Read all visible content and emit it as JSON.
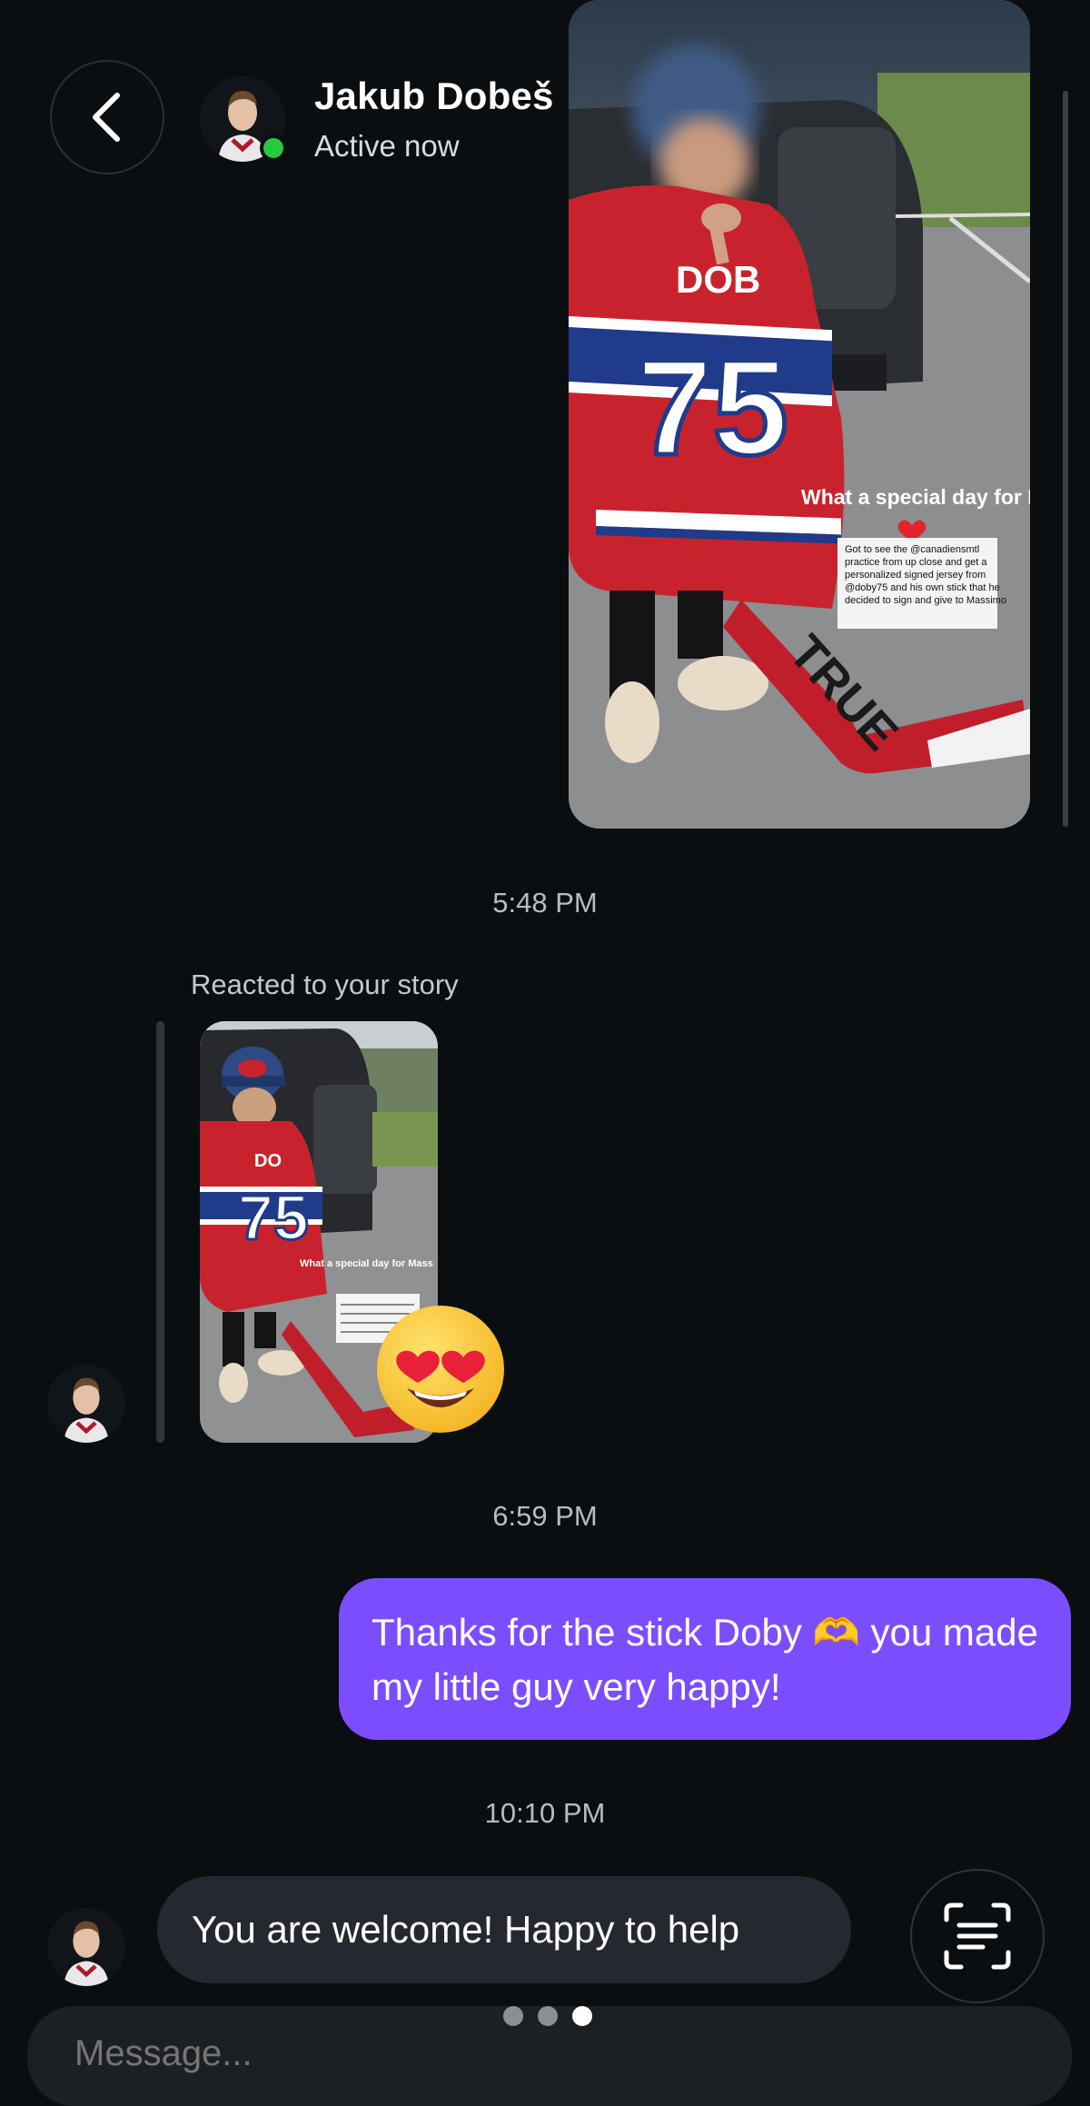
{
  "header": {
    "contact_name": "Jakub Dobeš",
    "status": "Active now",
    "verified": true,
    "icons": {
      "back": "chevron-left-icon",
      "verified": "verified-badge-icon"
    }
  },
  "thread": {
    "story_photo": {
      "jersey_name": "DOB",
      "jersey_number": "75",
      "caption_title": "What a special day for Mass",
      "caption_body": "Got to see the @canadiensmtl practice from up close and get a personalized signed jersey from @doby75 and his own stick that he decided to sign and give to Massimo",
      "stick_brand": "TRUE"
    },
    "timestamp_1": "5:48 PM",
    "reacted_label": "Reacted to your story",
    "reaction_emoji": "😍",
    "timestamp_2": "6:59 PM",
    "outgoing_message": "Thanks for the stick Doby 🫶 you made my little guy very happy!",
    "timestamp_3": "10:10 PM",
    "incoming_message": "You are welcome! Happy to help"
  },
  "composer": {
    "placeholder": "Message...",
    "page_dots": {
      "count": 3,
      "active_index": 2
    },
    "icons": {
      "scan": "text-scan-icon"
    }
  },
  "colors": {
    "background": "#0b0e11",
    "outgoing_bubble": "#7c4dff",
    "incoming_bubble": "#25292f",
    "online": "#27c93f",
    "verified": "#1d9bf0"
  }
}
